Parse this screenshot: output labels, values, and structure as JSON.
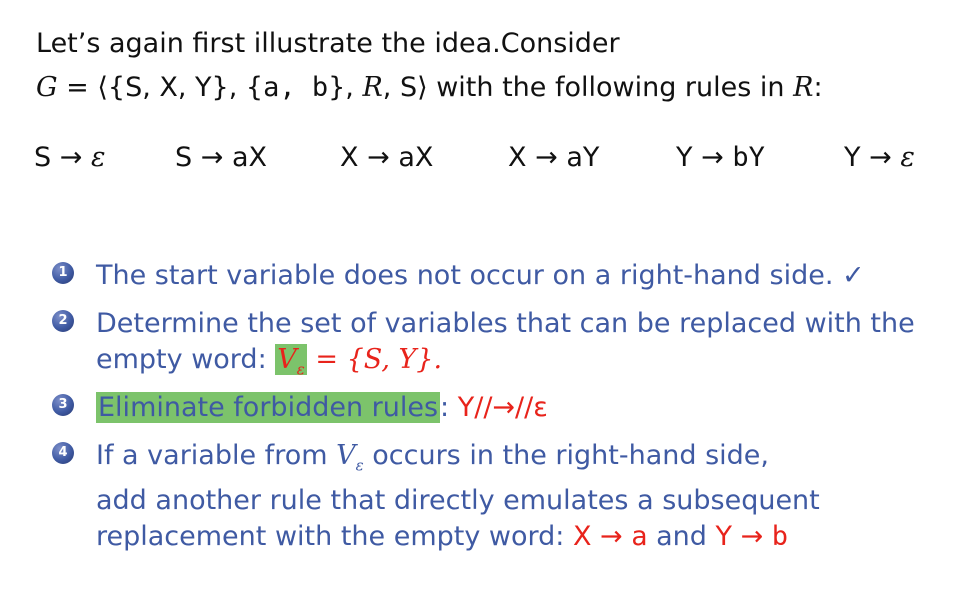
{
  "intro": {
    "line1": "Let’s again first illustrate the idea.Consider",
    "grammar_G": "G",
    "grammar_eq": " = ⟨{S, X, Y}, {",
    "grammar_ab": "a, b",
    "grammar_mid": "}, ",
    "grammar_R": "R",
    "grammar_end": ", S⟩",
    "grammar_text": " with the following rules in ",
    "grammar_R2": "R",
    "grammar_colon": ":"
  },
  "rules": [
    {
      "lhs": "S",
      "arrow": "→",
      "rhs": "ε"
    },
    {
      "lhs": "S",
      "arrow": "→",
      "rhs": "aX"
    },
    {
      "lhs": "X",
      "arrow": "→",
      "rhs": "aX"
    },
    {
      "lhs": "X",
      "arrow": "→",
      "rhs": "aY"
    },
    {
      "lhs": "Y",
      "arrow": "→",
      "rhs": "bY"
    },
    {
      "lhs": "Y",
      "arrow": "→",
      "rhs": "ε"
    }
  ],
  "steps": [
    {
      "num": "1",
      "text": "The start variable does not occur on a right-hand side.",
      "check": "✓"
    },
    {
      "num": "2",
      "line1": "Determine the set of variables that can be replaced with the",
      "line2": "empty word: ",
      "v": "V",
      "v_sub": "ε",
      "set": " = {S, Y}."
    },
    {
      "num": "3",
      "highlight": "Eliminate forbidden rules",
      "colon": ": ",
      "struck": "Y//→//ε"
    },
    {
      "num": "4",
      "line1_a": "If a variable from ",
      "v": "V",
      "v_sub": "ε",
      "line1_b": " occurs in the right-hand side,",
      "line2": "add another rule that directly emulates a subsequent",
      "line3_a": "replacement with the empty word: ",
      "rule1": "X → ",
      "rule1_t": "a",
      "and": " and ",
      "rule2": "Y → ",
      "rule2_t": "b"
    }
  ]
}
